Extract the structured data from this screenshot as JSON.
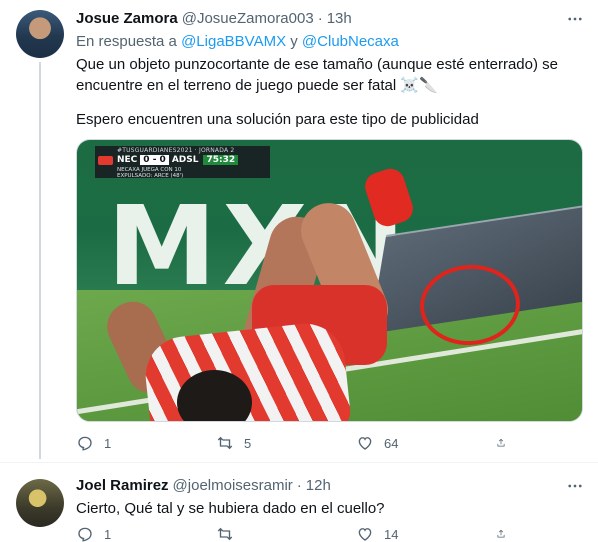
{
  "tweets": [
    {
      "author_name": "Josue Zamora",
      "author_handle": "@JosueZamora003",
      "separator": "·",
      "time": "13h",
      "reply_prefix": "En respuesta a",
      "reply_mention_1": "@LigaBBVAMX",
      "reply_and": "y",
      "reply_mention_2": "@ClubNecaxa",
      "text_1": "Que un objeto punzocortante de ese tamaño (aunque esté enterrado) se encuentre en el terreno de juego puede ser fatal ☠️🔪",
      "text_2": "Espero encuentren una solución para este tipo de publicidad",
      "media": {
        "board_text": "MXN",
        "scorebug": {
          "hashtag": "#TUSGUARDIANES2021 · JORNADA 2",
          "home": "NEC",
          "score": "0 - 0",
          "away": "ADSL",
          "clock": "75:32",
          "note_1": "NECAXA JUEGA CON 10",
          "note_2": "EXPULSADO: ARCE (48')"
        }
      },
      "stats": {
        "replies": "1",
        "retweets": "5",
        "likes": "64"
      }
    },
    {
      "author_name": "Joel Ramirez",
      "author_handle": "@joelmoisesramir",
      "separator": "·",
      "time": "12h",
      "text": "Cierto, Qué tal y se hubiera dado en el cuello?",
      "stats": {
        "replies": "1",
        "retweets": "",
        "likes": "14"
      }
    }
  ],
  "icons": {
    "more": "more-icon",
    "reply": "reply-icon",
    "retweet": "retweet-icon",
    "like": "like-icon",
    "share": "share-icon"
  },
  "colors": {
    "accent": "#1d9bf0",
    "secondary_text": "#536471",
    "primary_text": "#0f1419",
    "circle_highlight": "#e0241b"
  }
}
